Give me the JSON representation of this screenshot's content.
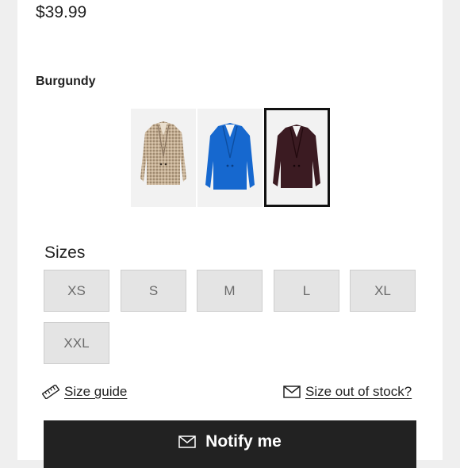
{
  "product": {
    "price": "$39.99",
    "selected_color": "Burgundy"
  },
  "swatches": [
    {
      "color_name": "beige-check",
      "jacket_color": "#c9b49a",
      "accent": "#a89276"
    },
    {
      "color_name": "blue",
      "jacket_color": "#1668cf",
      "accent": "#0f52a8"
    },
    {
      "color_name": "burgundy",
      "jacket_color": "#3b1b22",
      "accent": "#2a1117",
      "selected": true
    }
  ],
  "sizes": {
    "title": "Sizes",
    "options": [
      "XS",
      "S",
      "M",
      "L",
      "XL",
      "XXL"
    ]
  },
  "links": {
    "size_guide": "Size guide",
    "size_out_of_stock": "Size out of stock?"
  },
  "notify": {
    "label": "Notify me"
  },
  "icons": {
    "size_guide": "ruler-icon",
    "out_of_stock": "envelope-icon",
    "notify": "envelope-icon"
  }
}
